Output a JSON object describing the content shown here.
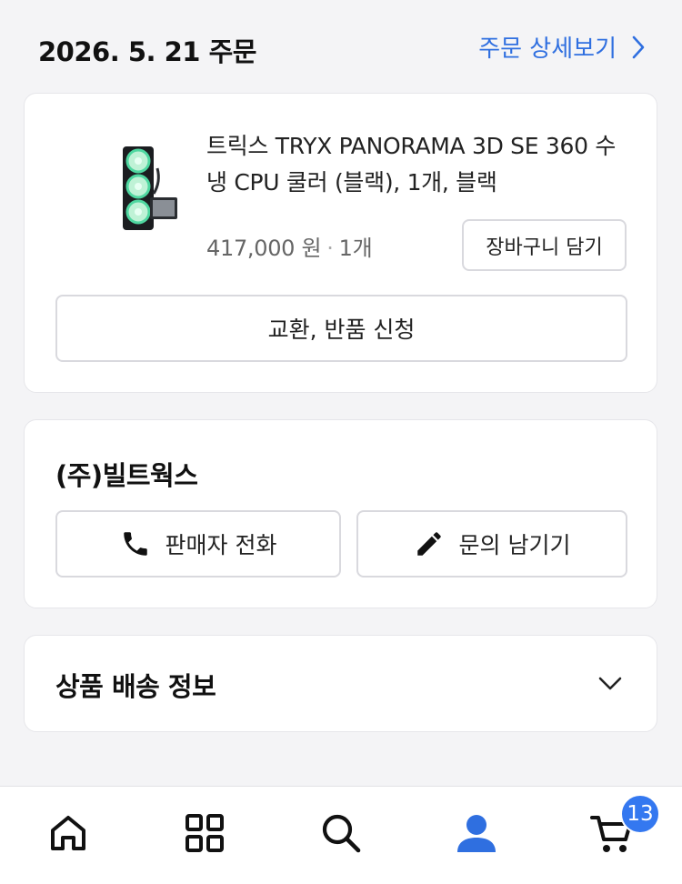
{
  "order": {
    "date_title": "2026. 5. 21 주문",
    "detail_link": "주문 상세보기"
  },
  "product": {
    "name": "트릭스 TRYX PANORAMA 3D SE 360 수냉 CPU 쿨러 (블랙), 1개, 블랙",
    "price": "417,000 원",
    "separator": "·",
    "quantity": "1개",
    "cart_button": "장바구니 담기",
    "return_button": "교환, 반품 신청"
  },
  "seller": {
    "name": "(주)빌트웍스",
    "call_button": "판매자 전화",
    "inquiry_button": "문의 남기기"
  },
  "shipping": {
    "title": "상품 배송 정보"
  },
  "bottom_nav": {
    "items": [
      {
        "icon": "home-icon"
      },
      {
        "icon": "category-grid-icon"
      },
      {
        "icon": "search-icon"
      },
      {
        "icon": "user-icon",
        "active": true
      },
      {
        "icon": "cart-icon"
      }
    ],
    "cart_badge": "13"
  },
  "colors": {
    "accent": "#2f6fe0",
    "badge": "#3478f0",
    "background": "#f4f4f6"
  }
}
